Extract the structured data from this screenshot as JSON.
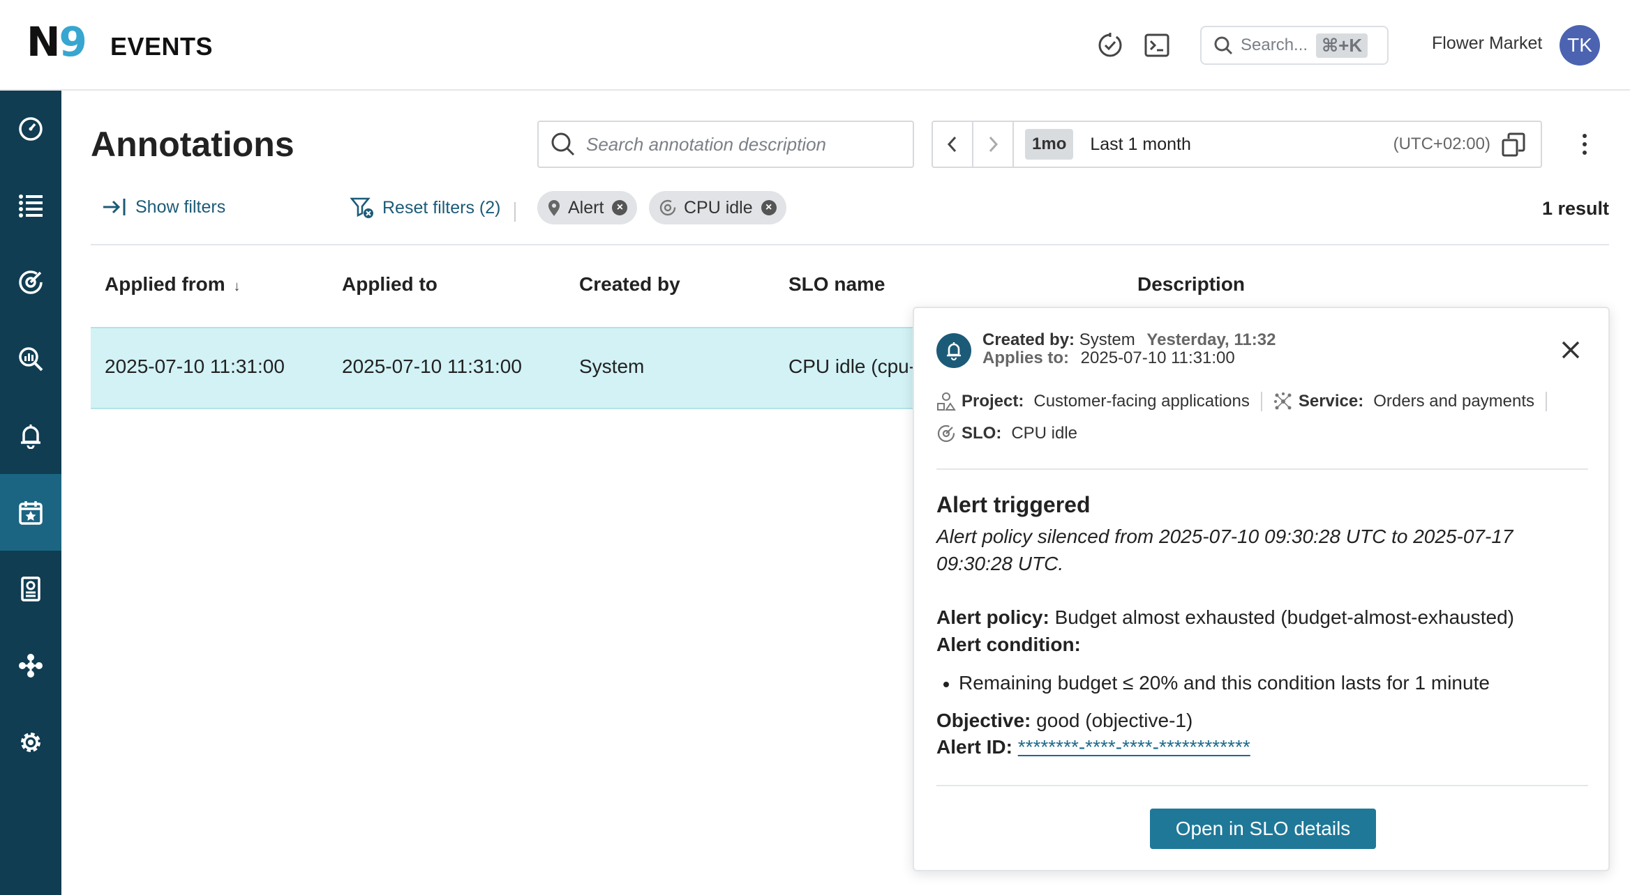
{
  "header": {
    "logo_n": "N",
    "logo_9": "9",
    "app_title": "EVENTS",
    "search_placeholder": "Search...",
    "search_shortcut": "⌘+K",
    "org_name": "Flower Market",
    "avatar_initials": "TK"
  },
  "sidebar": {
    "items": [
      {
        "icon": "dashboard-gauge-icon",
        "active": false
      },
      {
        "icon": "catalog-list-icon",
        "active": false
      },
      {
        "icon": "slo-target-icon",
        "active": false
      },
      {
        "icon": "query-analytics-icon",
        "active": false
      },
      {
        "icon": "alerts-bell-icon",
        "active": false
      },
      {
        "icon": "events-calendar-icon",
        "active": true
      },
      {
        "icon": "reports-icon",
        "active": false
      },
      {
        "icon": "integrations-icon",
        "active": false
      },
      {
        "icon": "settings-gear-icon",
        "active": false
      }
    ]
  },
  "page": {
    "title": "Annotations",
    "search_placeholder": "Search annotation description",
    "time_chip": "1mo",
    "time_label": "Last 1 month",
    "timezone": "(UTC+02:00)",
    "show_filters": "Show filters",
    "reset_filters": "Reset filters (2)",
    "chips": [
      {
        "label": "Alert",
        "icon": "pin-icon"
      },
      {
        "label": "CPU idle",
        "icon": "slo-target-icon"
      }
    ],
    "result_count": "1 result"
  },
  "table": {
    "columns": [
      "Applied from",
      "Applied to",
      "Created by",
      "SLO name",
      "Description"
    ],
    "sort_indicator": "↓",
    "rows": [
      [
        "2025-07-10 11:31:00",
        "2025-07-10 11:31:00",
        "System",
        "CPU idle (cpu-",
        ""
      ]
    ]
  },
  "popover": {
    "created_by_label": "Created by:",
    "created_by": "System",
    "created_when": "Yesterday, 11:32",
    "applies_to_label": "Applies to:",
    "applies_to": "2025-07-10 11:31:00",
    "project_label": "Project:",
    "project": "Customer-facing applications",
    "service_label": "Service:",
    "service": "Orders and payments",
    "slo_label": "SLO:",
    "slo": "CPU idle",
    "alert_title": "Alert triggered",
    "alert_desc": "Alert policy silenced from 2025-07-10 09:30:28 UTC to 2025-07-17 09:30:28 UTC.",
    "policy_label": "Alert policy:",
    "policy": "Budget almost exhausted (budget-almost-exhausted)",
    "condition_label": "Alert condition:",
    "condition": "Remaining budget ≤ 20% and this condition lasts for 1 minute",
    "objective_label": "Objective:",
    "objective": "good (objective-1)",
    "alert_id_label": "Alert ID:",
    "alert_id": "********-****-****-************",
    "open_button": "Open in SLO details"
  }
}
